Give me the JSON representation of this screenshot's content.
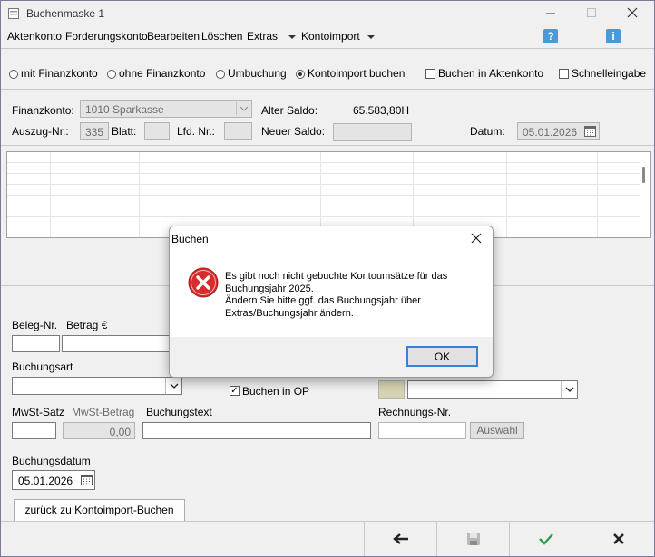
{
  "window": {
    "title": "Buchenmaske 1"
  },
  "menu": {
    "items": [
      "Aktenkonto",
      "Forderungskonto",
      "Bearbeiten",
      "Löschen",
      "Extras"
    ],
    "dropdown_label": "Kontoimport"
  },
  "mode": {
    "options": [
      "mit Finanzkonto",
      "ohne Finanzkonto",
      "Umbuchung",
      "Kontoimport buchen"
    ],
    "selected": "Kontoimport buchen",
    "check_aktenkonto": "Buchen in Aktenkonto",
    "check_schnell": "Schnelleingabe"
  },
  "header": {
    "finanzkonto_label": "Finanzkonto:",
    "finanzkonto_value": "1010 Sparkasse",
    "alter_saldo_label": "Alter Saldo:",
    "alter_saldo_value": "65.583,80H",
    "auszug_label": "Auszug-Nr.:",
    "auszug_value": "335",
    "blatt_label": "Blatt:",
    "lfd_label": "Lfd. Nr.:",
    "neuer_saldo_label": "Neuer Saldo:",
    "datum_label": "Datum:",
    "datum_value": "05.01.2026"
  },
  "form": {
    "beleg_label": "Beleg-Nr.",
    "betrag_label": "Betrag €",
    "buchungsart_label": "Buchungsart",
    "buchen_op_label": "Buchen in OP",
    "mwst_satz_label": "MwSt-Satz",
    "mwst_betrag_label": "MwSt-Betrag",
    "mwst_betrag_value": "0,00",
    "buchungstext_label": "Buchungstext",
    "rechnungs_label": "Rechnungs-Nr.",
    "auswahl_label": "Auswahl",
    "buchungsdatum_label": "Buchungsdatum",
    "buchungsdatum_value": "05.01.2026",
    "zurueck_label": "zurück zu Kontoimport-Buchen"
  },
  "dialog": {
    "title": "Buchen",
    "message_line1": "Es gibt noch nicht gebuchte Kontoumsätze für das",
    "message_line2": "Buchungsjahr 2025.",
    "message_line3": "Ändern Sie bitte ggf. das Buchungsjahr über",
    "message_line4": "Extras/Buchungsjahr ändern.",
    "ok_label": "OK"
  },
  "colors": {
    "accent_help": "#2e8bd0",
    "ok_green": "#2f9e4f",
    "error_red": "#d82c2c"
  }
}
